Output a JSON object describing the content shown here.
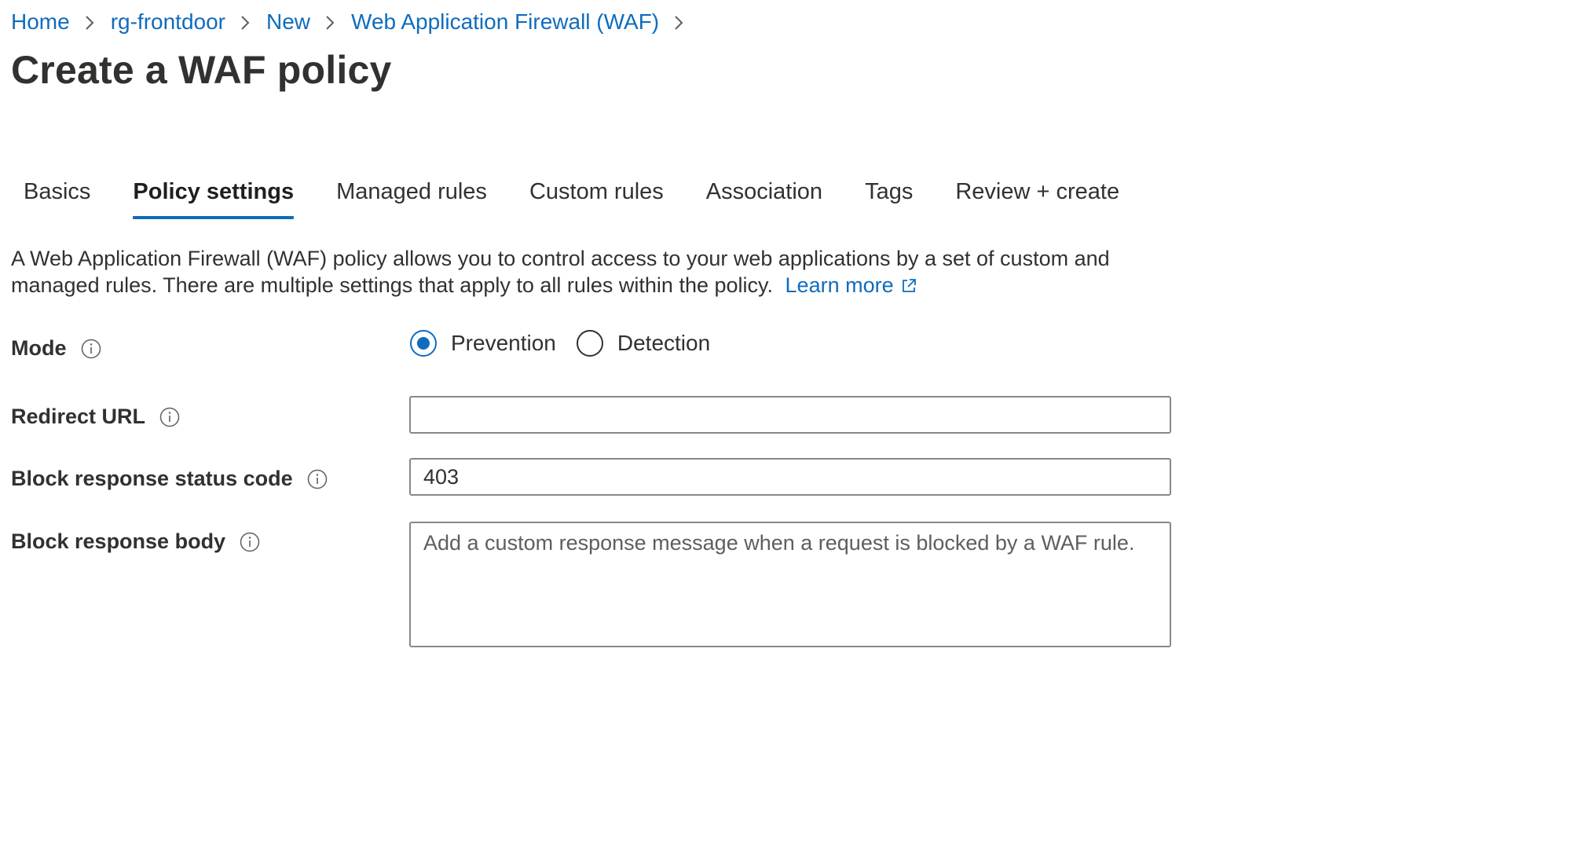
{
  "breadcrumb": {
    "items": [
      "Home",
      "rg-frontdoor",
      "New",
      "Web Application Firewall (WAF)"
    ]
  },
  "page": {
    "title": "Create a WAF policy"
  },
  "tabs": [
    {
      "label": "Basics",
      "active": false
    },
    {
      "label": "Policy settings",
      "active": true
    },
    {
      "label": "Managed rules",
      "active": false
    },
    {
      "label": "Custom rules",
      "active": false
    },
    {
      "label": "Association",
      "active": false
    },
    {
      "label": "Tags",
      "active": false
    },
    {
      "label": "Review + create",
      "active": false
    }
  ],
  "description": {
    "text": "A Web Application Firewall (WAF) policy allows you to control access to your web applications by a set of custom and managed rules. There are multiple settings that apply to all rules within the policy.",
    "link_label": "Learn more"
  },
  "form": {
    "mode": {
      "label": "Mode",
      "options": [
        "Prevention",
        "Detection"
      ],
      "selected": "Prevention"
    },
    "redirect_url": {
      "label": "Redirect URL",
      "value": ""
    },
    "block_status_code": {
      "label": "Block response status code",
      "value": "403"
    },
    "block_response_body": {
      "label": "Block response body",
      "placeholder": "Add a custom response message when a request is blocked by a WAF rule."
    }
  },
  "colors": {
    "accent": "#0f6cbd",
    "text": "#323130",
    "border": "#8a8886"
  },
  "icons": {
    "breadcrumb_separator": "chevron-right-icon",
    "info": "info-icon",
    "external_link": "external-link-icon"
  }
}
